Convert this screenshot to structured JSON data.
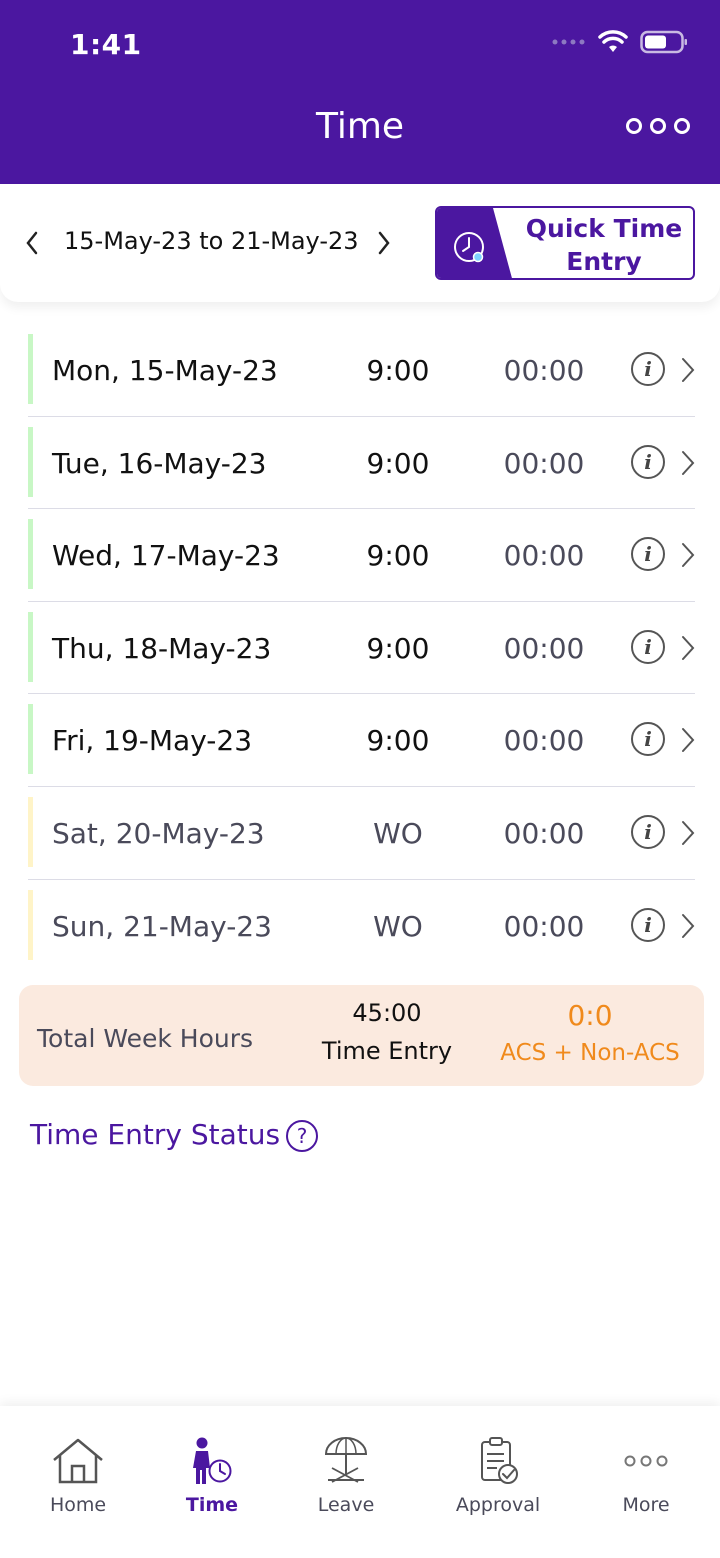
{
  "status_bar": {
    "time": "1:41"
  },
  "header": {
    "title": "Time"
  },
  "week": {
    "range": "15-May-23 to 21-May-23",
    "quick_entry_label_line1": "Quick Time",
    "quick_entry_label_line2": "Entry"
  },
  "days": [
    {
      "date": "Mon, 15-May-23",
      "hours": "9:00",
      "entry": "00:00",
      "type": "weekday"
    },
    {
      "date": "Tue, 16-May-23",
      "hours": "9:00",
      "entry": "00:00",
      "type": "weekday"
    },
    {
      "date": "Wed, 17-May-23",
      "hours": "9:00",
      "entry": "00:00",
      "type": "weekday"
    },
    {
      "date": "Thu, 18-May-23",
      "hours": "9:00",
      "entry": "00:00",
      "type": "weekday"
    },
    {
      "date": "Fri, 19-May-23",
      "hours": "9:00",
      "entry": "00:00",
      "type": "weekday"
    },
    {
      "date": "Sat, 20-May-23",
      "hours": "WO",
      "entry": "00:00",
      "type": "weekend"
    },
    {
      "date": "Sun, 21-May-23",
      "hours": "WO",
      "entry": "00:00",
      "type": "weekend"
    }
  ],
  "totals": {
    "label": "Total Week Hours",
    "hours": "45:00",
    "hours_label": "Time Entry",
    "acs_value": "0:0",
    "acs_label": "ACS + Non-ACS"
  },
  "time_entry_status": {
    "label": "Time Entry Status",
    "help_glyph": "?"
  },
  "tabs": [
    {
      "label": "Home",
      "icon": "home-icon"
    },
    {
      "label": "Time",
      "icon": "time-icon",
      "active": true
    },
    {
      "label": "Leave",
      "icon": "leave-icon"
    },
    {
      "label": "Approval",
      "icon": "approval-icon"
    },
    {
      "label": "More",
      "icon": "more-icon"
    }
  ],
  "colors": {
    "brand": "#4b17a0",
    "weekday_bar": "#c8f7c5",
    "weekend_bar": "#fff4c8",
    "acs": "#f08a1c",
    "total_card_bg": "#fbeadf"
  }
}
